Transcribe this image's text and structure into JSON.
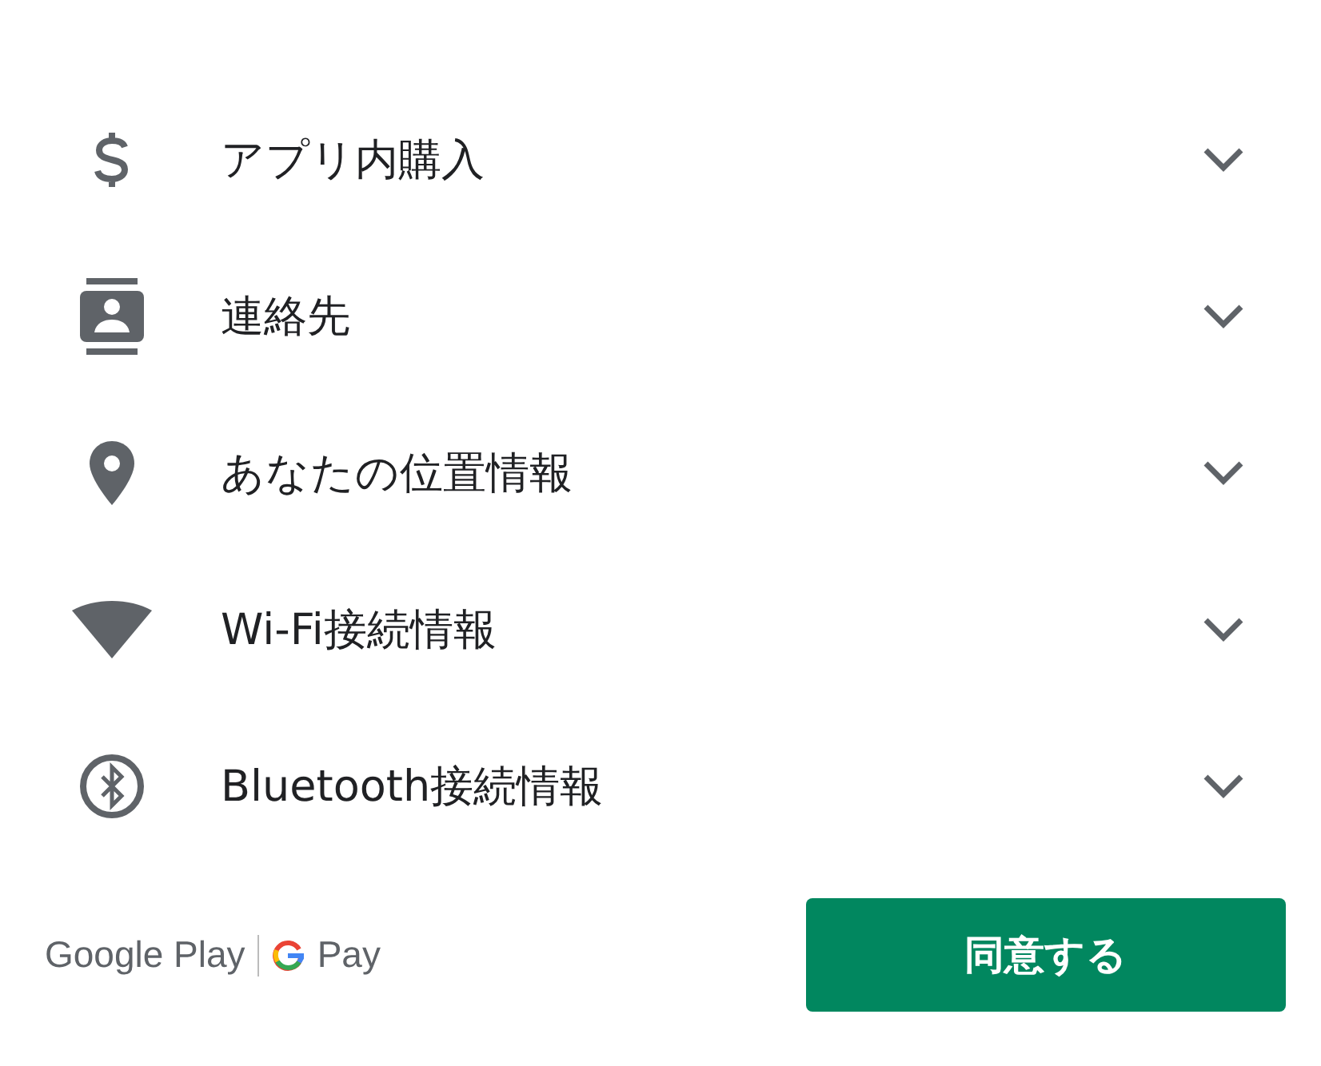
{
  "permissions": [
    {
      "kind": "dollar",
      "label": "アプリ内購入",
      "expanded": false
    },
    {
      "kind": "contact",
      "label": "連絡先",
      "expanded": false
    },
    {
      "kind": "location",
      "label": "あなたの位置情報",
      "expanded": false
    },
    {
      "kind": "wifi",
      "label": "Wi-Fi接続情報",
      "expanded": false
    },
    {
      "kind": "bluetooth",
      "label": "Bluetooth接続情報",
      "expanded": false
    }
  ],
  "footer": {
    "brand": "Google Play",
    "pay": "Pay",
    "button": "同意する"
  }
}
